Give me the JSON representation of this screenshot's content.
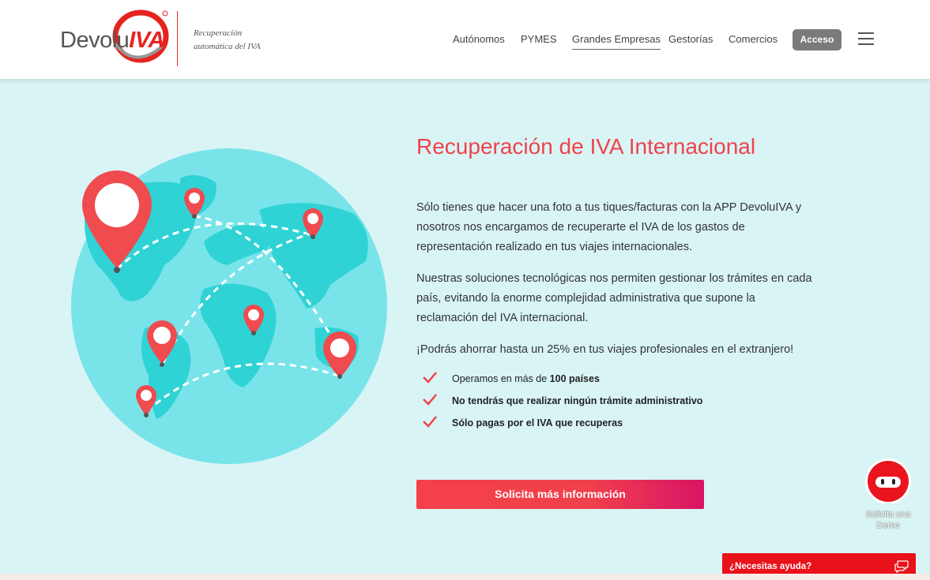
{
  "header": {
    "logo_text_regular": "Devolu",
    "logo_text_bold": "IVA",
    "tagline_line1": "Recuperación",
    "tagline_line2": "automática del IVA",
    "nav": [
      {
        "label": "Autónomos"
      },
      {
        "label": "PYMES"
      },
      {
        "label": "Grandes Empresas"
      },
      {
        "label": "Gestorías"
      },
      {
        "label": "Comercios"
      }
    ],
    "active_nav": "Grandes Empresas",
    "access_label": "Acceso",
    "menu_icon": "hamburger-icon"
  },
  "hero": {
    "title": "Recuperación de IVA Internacional",
    "paragraph1": "Sólo tienes que hacer una foto a tus tiques/facturas con la APP DevoluIVA y nosotros nos encargamos de recuperarte el IVA de los gastos de representación realizado en tus viajes internacionales.",
    "paragraph2": "Nuestras soluciones tecnológicas nos permiten gestionar los trámites en cada país, evitando la enorme complejidad administrativa que supone la reclamación del IVA internacional.",
    "paragraph3": "¡Podrás ahorrar hasta un 25% en tus viajes profesionales en el extranjero!",
    "checklist": [
      {
        "prefix": "Operamos en más de ",
        "bold": "100 países"
      },
      {
        "prefix": "No tendrás que realizar ningún trámite administrativo",
        "bold": ""
      },
      {
        "prefix": "Sólo pagas por el IVA que recuperas",
        "bold": ""
      }
    ],
    "cta_label": "Solicita más información"
  },
  "widgets": {
    "demo_label_line1": "Solicita una",
    "demo_label_line2": "Demo",
    "help_label": "¿Necesitas ayuda?"
  },
  "colors": {
    "accent": "#f0434a",
    "background": "#d9f4f5",
    "globe_ocean": "#79e3ea",
    "globe_land": "#2fd3d5",
    "help_bar": "#e9111a"
  }
}
